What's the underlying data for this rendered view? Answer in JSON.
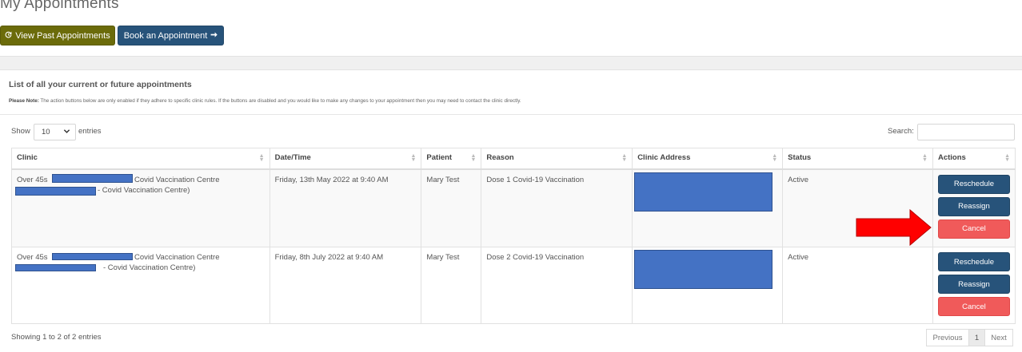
{
  "page": {
    "title": "My Appointments"
  },
  "toolbar": {
    "past_label": "View Past Appointments",
    "book_label": "Book an Appointment"
  },
  "section": {
    "title": "List of all your current or future appointments",
    "note_label": "Please Note:",
    "note_text": " The action buttons below are only enabled if they adhere to specific clinic rules. If the buttons are disabled and you would like to make any changes to your appointment then you may need to contact the clinic directly."
  },
  "length_menu": {
    "show_label": "Show",
    "value": "10",
    "entries_label": "entries"
  },
  "search": {
    "label": "Search:",
    "value": ""
  },
  "table": {
    "columns": [
      "Clinic",
      "Date/Time",
      "Patient",
      "Reason",
      "Clinic Address",
      "Status",
      "Actions"
    ],
    "rows": [
      {
        "clinic_line1_start": "Over 45s",
        "clinic_line1_end": "Covid Vaccination Centre",
        "clinic_line2_end": "- Covid Vaccination Centre)",
        "datetime": "Friday, 13th May 2022 at 9:40 AM",
        "patient": "Mary Test",
        "reason": "Dose 1 Covid-19 Vaccination",
        "status": "Active",
        "actions": [
          "Reschedule",
          "Reassign",
          "Cancel"
        ]
      },
      {
        "clinic_line1_start": "Over 45s",
        "clinic_line1_end": "Covid Vaccination Centre",
        "clinic_line2_end": "- Covid Vaccination Centre)",
        "datetime": "Friday, 8th July 2022 at 9:40 AM",
        "patient": "Mary Test",
        "reason": "Dose 2 Covid-19 Vaccination",
        "status": "Active",
        "actions": [
          "Reschedule",
          "Reassign",
          "Cancel"
        ]
      }
    ]
  },
  "footer": {
    "info": "Showing 1 to 2 of 2 entries",
    "prev": "Previous",
    "page": "1",
    "next": "Next"
  },
  "colors": {
    "past_button": "#6b6b0a",
    "primary_button": "#27537a",
    "cancel_button": "#f05a5a",
    "redaction": "#4472c4",
    "annotation_arrow": "#ff0000"
  },
  "icons": {
    "past": "history-icon",
    "book": "arrow-right-icon",
    "sort": "sort-icon",
    "select": "chevron-down-icon"
  }
}
